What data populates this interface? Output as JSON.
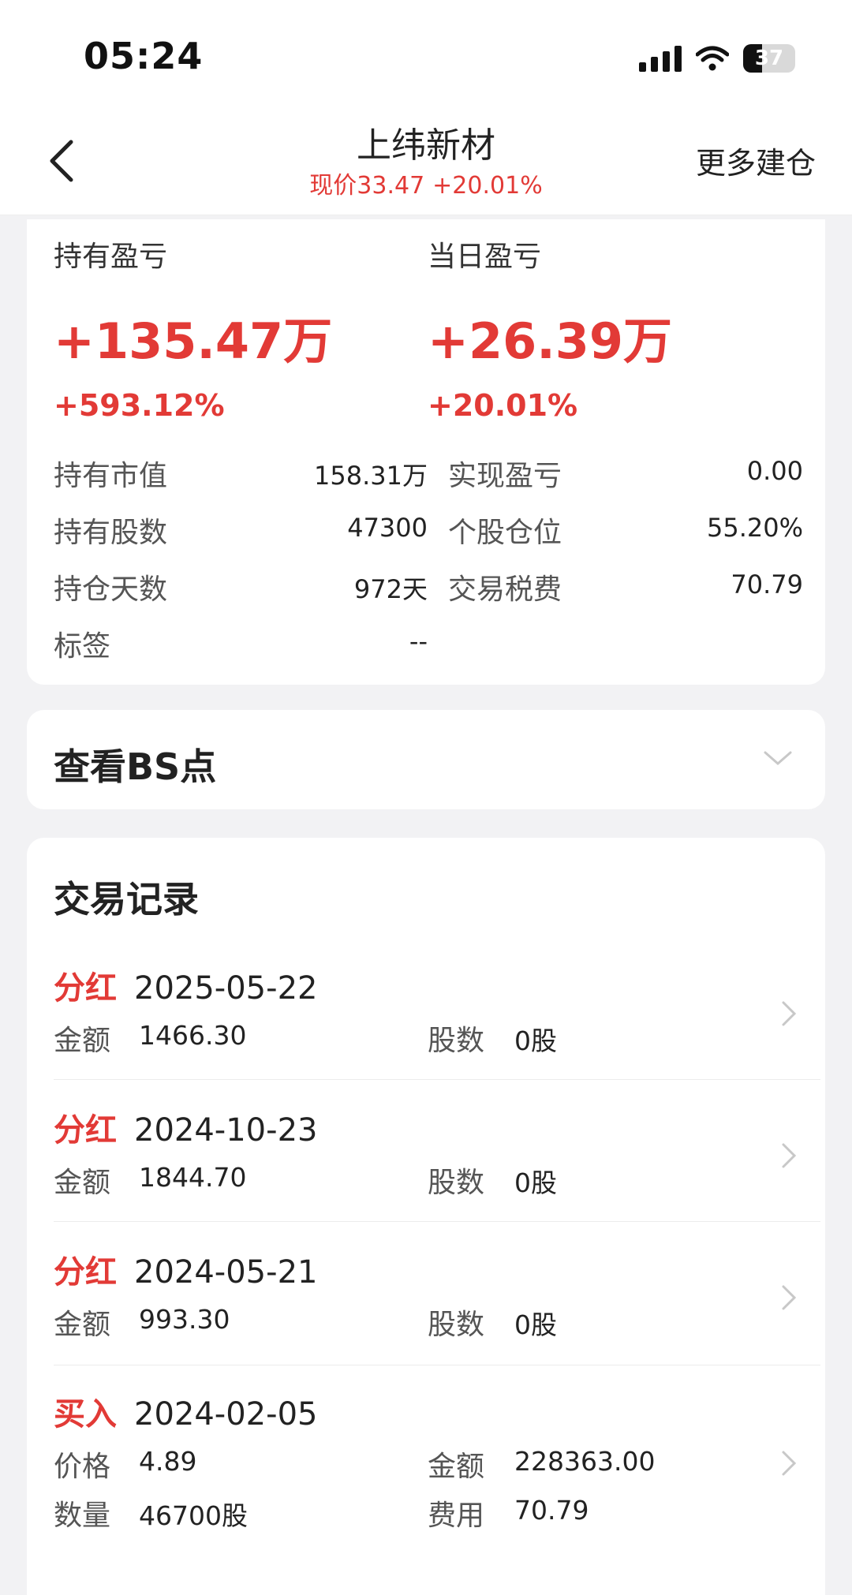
{
  "status_bar": {
    "time": "05:24",
    "battery": "37"
  },
  "nav": {
    "title": "上纬新材",
    "price_label": "现价33.47",
    "price_change": "+20.01%",
    "right_action": "更多建仓"
  },
  "pl": {
    "holding": {
      "label": "持有盈亏",
      "value": "+135.47万",
      "pct": "+593.12%"
    },
    "today": {
      "label": "当日盈亏",
      "value": "+26.39万",
      "pct": "+20.01%"
    }
  },
  "stats": {
    "rows": [
      [
        {
          "label": "持有市值",
          "value": "158.31万"
        },
        {
          "label": "实现盈亏",
          "value": "0.00"
        }
      ],
      [
        {
          "label": "持有股数",
          "value": "47300"
        },
        {
          "label": "个股仓位",
          "value": "55.20%"
        }
      ],
      [
        {
          "label": "持仓天数",
          "value": "972天"
        },
        {
          "label": "交易税费",
          "value": "70.79"
        }
      ],
      [
        {
          "label": "标签",
          "value": "--"
        }
      ]
    ]
  },
  "bs": {
    "title": "查看BS点"
  },
  "trades": {
    "title": "交易记录",
    "records": [
      {
        "type": "分红",
        "date": "2025-05-22",
        "k1": "金额",
        "v1": "1466.30",
        "k2": "股数",
        "v2": "0股"
      },
      {
        "type": "分红",
        "date": "2024-10-23",
        "k1": "金额",
        "v1": "1844.70",
        "k2": "股数",
        "v2": "0股"
      },
      {
        "type": "分红",
        "date": "2024-05-21",
        "k1": "金额",
        "v1": "993.30",
        "k2": "股数",
        "v2": "0股"
      },
      {
        "type": "买入",
        "date": "2024-02-05",
        "k1": "价格",
        "v1": "4.89",
        "k2": "金额",
        "v2": "228363.00",
        "k3": "数量",
        "v3": "46700股",
        "k4": "费用",
        "v4": "70.79"
      }
    ]
  },
  "colors": {
    "accent_red": "#e23a36"
  }
}
